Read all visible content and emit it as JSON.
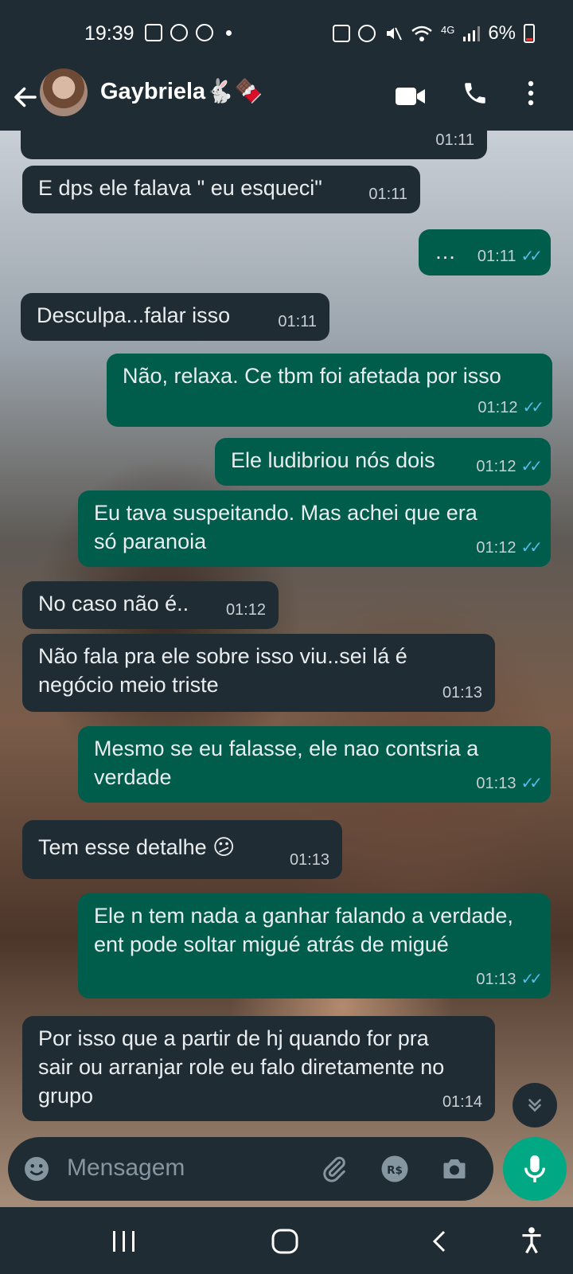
{
  "status_bar": {
    "time": "19:39",
    "battery": "6%",
    "network": "4G"
  },
  "header": {
    "contact_name": "Gaybriela🐇🍫",
    "icons": [
      "back-arrow-icon",
      "avatar",
      "video-call-icon",
      "phone-icon",
      "more-icon"
    ]
  },
  "messages": [
    {
      "dir": "in",
      "text": "",
      "time": "01:11"
    },
    {
      "dir": "in",
      "text": "E dps ele falava \" eu esqueci\"",
      "time": "01:11"
    },
    {
      "dir": "out",
      "text": "…",
      "time": "01:11"
    },
    {
      "dir": "in",
      "text": "Desculpa...falar isso",
      "time": "01:11"
    },
    {
      "dir": "out",
      "text": "Não, relaxa. Ce tbm foi afetada por isso",
      "time": "01:12"
    },
    {
      "dir": "out",
      "text": "Ele ludibriou nós dois",
      "time": "01:12"
    },
    {
      "dir": "out",
      "text": "Eu tava suspeitando. Mas achei que era só paranoia",
      "time": "01:12"
    },
    {
      "dir": "in",
      "text": "No caso não é..",
      "time": "01:12"
    },
    {
      "dir": "in",
      "text": "Não fala pra ele sobre isso viu..sei lá é negócio meio triste",
      "time": "01:13"
    },
    {
      "dir": "out",
      "text": "Mesmo se eu falasse, ele nao contsria a verdade",
      "time": "01:13"
    },
    {
      "dir": "in",
      "text": "Tem esse detalhe 😕",
      "time": "01:13"
    },
    {
      "dir": "out",
      "text": "Ele n tem nada a ganhar falando a verdade, ent pode soltar migué atrás de migué",
      "time": "01:13"
    },
    {
      "dir": "in",
      "text": "Por isso que a partir de hj quando for pra sair ou arranjar role eu falo diretamente no grupo",
      "time": "01:14"
    }
  ],
  "composer": {
    "placeholder": "Mensagem"
  },
  "colors": {
    "incoming": "#202c33",
    "outgoing": "#005c4b",
    "accent": "#00a884",
    "read_ticks": "#53bdeb"
  }
}
